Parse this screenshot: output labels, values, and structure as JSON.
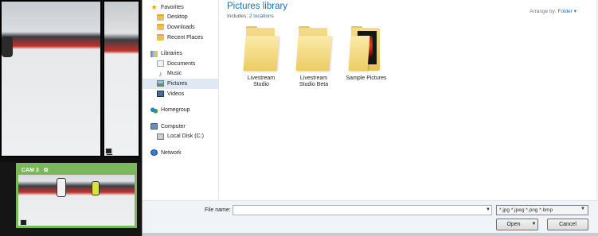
{
  "cameras": {
    "cam3_label": "CAM 3",
    "cam3_border_color": "#7bb85c"
  },
  "nav": {
    "favorites": {
      "header": "Favorites",
      "items": [
        "Desktop",
        "Downloads",
        "Recent Places"
      ]
    },
    "libraries": {
      "header": "Libraries",
      "items": [
        "Documents",
        "Music",
        "Pictures",
        "Videos"
      ],
      "selected": "Pictures"
    },
    "homegroup": "Homegroup",
    "computer": {
      "header": "Computer",
      "items": [
        "Local Disk (C:)"
      ]
    },
    "network": "Network"
  },
  "content": {
    "title": "Pictures library",
    "includes_label": "Includes:",
    "includes_link": "2 locations",
    "arrange_label": "Arrange by:",
    "arrange_value": "Folder",
    "folders": [
      {
        "line1": "Livestream",
        "line2": "Studio",
        "has_photo": false
      },
      {
        "line1": "Livestream",
        "line2": "Studio Beta",
        "has_photo": false
      },
      {
        "line1": "Sample Pictures",
        "line2": "",
        "has_photo": true
      }
    ]
  },
  "footer": {
    "file_name_label": "File name:",
    "file_name_value": "",
    "filter": "*.jpg *.jpeg *.png *.bmp",
    "open_label": "Open",
    "cancel_label": "Cancel"
  },
  "colors": {
    "accent_link": "#1e6fb9",
    "selection": "#dfe9f5"
  }
}
